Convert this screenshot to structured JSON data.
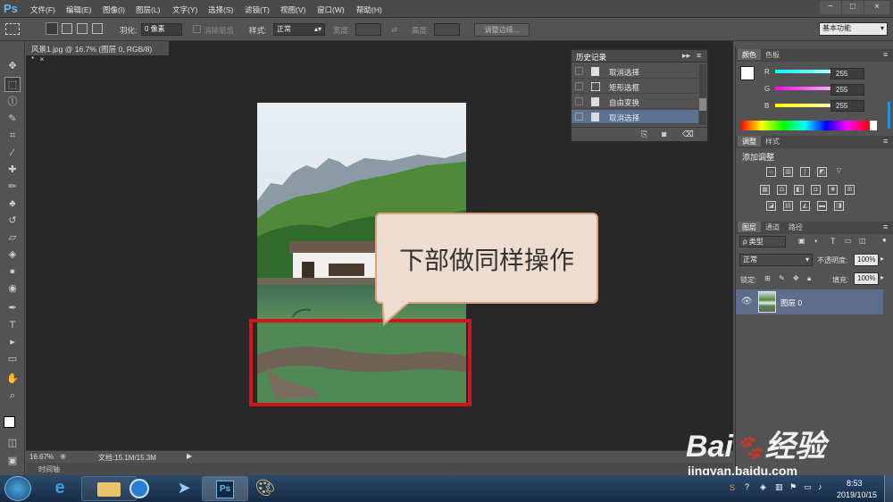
{
  "app": {
    "logo": "Ps"
  },
  "menu": [
    "文件(F)",
    "编辑(E)",
    "图像(I)",
    "图层(L)",
    "文字(Y)",
    "选择(S)",
    "滤镜(T)",
    "视图(V)",
    "窗口(W)",
    "帮助(H)"
  ],
  "window_controls": [
    "−",
    "□",
    "×"
  ],
  "options": {
    "feather_label": "羽化:",
    "feather_value": "0 像素",
    "antialias_label": "消除锯齿",
    "style_label": "样式:",
    "style_value": "正常",
    "width_label": "宽度:",
    "height_label": "高度:",
    "refine_button": "调整边缘...",
    "workspace": "基本功能"
  },
  "document": {
    "tab_title": "风景1.jpg @ 16.7% (图层 0, RGB/8) *",
    "zoom": "16.67%",
    "doc_size": "文档:15.1M/15.3M",
    "timeline": "时间轴"
  },
  "callout": {
    "text": "下部做同样操作"
  },
  "history": {
    "title": "历史记录",
    "items": [
      {
        "label": "取消选择",
        "icon": "document-icon"
      },
      {
        "label": "矩形选框",
        "icon": "marquee-icon"
      },
      {
        "label": "自由变换",
        "icon": "document-icon"
      },
      {
        "label": "取消选择",
        "icon": "document-icon",
        "selected": true
      }
    ]
  },
  "color_panel": {
    "tabs": [
      "颜色",
      "色板"
    ],
    "channels": [
      {
        "name": "R",
        "value": "255",
        "color": "#35c8d8"
      },
      {
        "name": "G",
        "value": "255",
        "color": "#d038c9"
      },
      {
        "name": "B",
        "value": "255",
        "color": "#e8e84a"
      }
    ]
  },
  "adjust_panel": {
    "tabs": [
      "调整",
      "样式"
    ],
    "title": "添加调整"
  },
  "layers_panel": {
    "tabs": [
      "图层",
      "通道",
      "路径"
    ],
    "filter": "ρ 类型",
    "blend": "正常",
    "opacity_label": "不透明度:",
    "opacity": "100%",
    "lock_label": "锁定:",
    "fill_label": "填充:",
    "fill": "100%",
    "layers": [
      {
        "name": "图层 0",
        "visible": true
      }
    ]
  },
  "watermark": {
    "line1": "Bai",
    "line1b": "经验",
    "line2": "jingyan.baidu.com"
  },
  "taskbar": {
    "time": "8:53",
    "date": "2019/10/15"
  },
  "colors": {
    "selection": "#d3141b",
    "history_selected": "#5d7192",
    "layer_selected": "#5d6d8a"
  }
}
